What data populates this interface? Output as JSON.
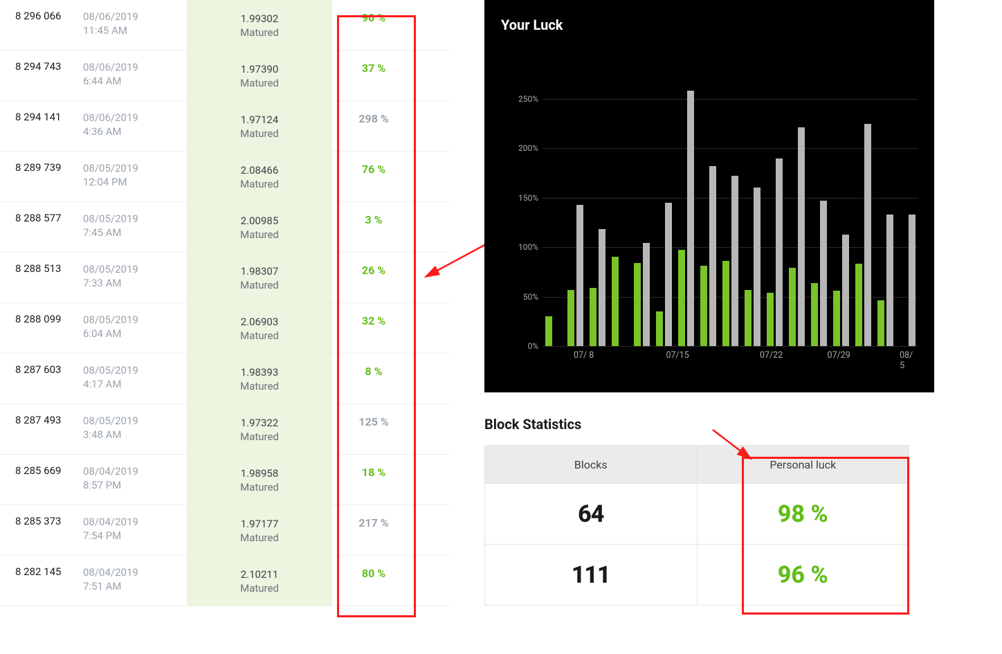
{
  "table": {
    "rows": [
      {
        "block": "8 296 066",
        "date": "08/06/2019",
        "time": "11:45 AM",
        "reward": "1.99302",
        "status": "Matured",
        "luck": "90 %",
        "luck_class": "luck-green"
      },
      {
        "block": "8 294 743",
        "date": "08/06/2019",
        "time": "6:44 AM",
        "reward": "1.97390",
        "status": "Matured",
        "luck": "37 %",
        "luck_class": "luck-green"
      },
      {
        "block": "8 294 141",
        "date": "08/06/2019",
        "time": "4:36 AM",
        "reward": "1.97124",
        "status": "Matured",
        "luck": "298 %",
        "luck_class": "luck-gray"
      },
      {
        "block": "8 289 739",
        "date": "08/05/2019",
        "time": "12:04 PM",
        "reward": "2.08466",
        "status": "Matured",
        "luck": "76 %",
        "luck_class": "luck-green"
      },
      {
        "block": "8 288 577",
        "date": "08/05/2019",
        "time": "7:45 AM",
        "reward": "2.00985",
        "status": "Matured",
        "luck": "3 %",
        "luck_class": "luck-green"
      },
      {
        "block": "8 288 513",
        "date": "08/05/2019",
        "time": "7:33 AM",
        "reward": "1.98307",
        "status": "Matured",
        "luck": "26 %",
        "luck_class": "luck-green"
      },
      {
        "block": "8 288 099",
        "date": "08/05/2019",
        "time": "6:04 AM",
        "reward": "2.06903",
        "status": "Matured",
        "luck": "32 %",
        "luck_class": "luck-green"
      },
      {
        "block": "8 287 603",
        "date": "08/05/2019",
        "time": "4:17 AM",
        "reward": "1.98393",
        "status": "Matured",
        "luck": "8 %",
        "luck_class": "luck-green"
      },
      {
        "block": "8 287 493",
        "date": "08/05/2019",
        "time": "3:48 AM",
        "reward": "1.97322",
        "status": "Matured",
        "luck": "125 %",
        "luck_class": "luck-gray"
      },
      {
        "block": "8 285 669",
        "date": "08/04/2019",
        "time": "8:57 PM",
        "reward": "1.98958",
        "status": "Matured",
        "luck": "18 %",
        "luck_class": "luck-green"
      },
      {
        "block": "8 285 373",
        "date": "08/04/2019",
        "time": "7:54 PM",
        "reward": "1.97177",
        "status": "Matured",
        "luck": "217 %",
        "luck_class": "luck-gray"
      },
      {
        "block": "8 282 145",
        "date": "08/04/2019",
        "time": "7:51 AM",
        "reward": "2.10211",
        "status": "Matured",
        "luck": "80 %",
        "luck_class": "luck-green"
      }
    ]
  },
  "chart": {
    "title": "Your Luck"
  },
  "chart_data": {
    "type": "bar",
    "title": "Your Luck",
    "xlabel": "",
    "ylabel": "",
    "ylim": [
      0,
      280
    ],
    "yticks": [
      "0%",
      "50%",
      "100%",
      "150%",
      "200%",
      "250%"
    ],
    "xticks": [
      {
        "label": "07/ 8",
        "pos": 11
      },
      {
        "label": "07/15",
        "pos": 36
      },
      {
        "label": "07/22",
        "pos": 61
      },
      {
        "label": "07/29",
        "pos": 79
      },
      {
        "label": "08/ 5",
        "pos": 97
      }
    ],
    "series_legend": [
      "green",
      "gray"
    ],
    "points": [
      {
        "g": 30,
        "s": null
      },
      {
        "g": 57,
        "s": 143
      },
      {
        "g": 59,
        "s": 118
      },
      {
        "g": 90,
        "s": null
      },
      {
        "g": 84,
        "s": 104
      },
      {
        "g": 35,
        "s": 145
      },
      {
        "g": 97,
        "s": 258
      },
      {
        "g": 81,
        "s": 182
      },
      {
        "g": 86,
        "s": 172
      },
      {
        "g": 57,
        "s": 160
      },
      {
        "g": 54,
        "s": 190
      },
      {
        "g": 79,
        "s": 221
      },
      {
        "g": 64,
        "s": 147
      },
      {
        "g": 56,
        "s": 113
      },
      {
        "g": 83,
        "s": 225
      },
      {
        "g": 46,
        "s": 133
      },
      {
        "g": null,
        "s": 133
      }
    ]
  },
  "stats": {
    "title": "Block Statistics",
    "headers": {
      "blocks": "Blocks",
      "luck": "Personal luck"
    },
    "rows": [
      {
        "blocks": "64",
        "luck": "98 %"
      },
      {
        "blocks": "111",
        "luck": "96 %"
      }
    ]
  }
}
